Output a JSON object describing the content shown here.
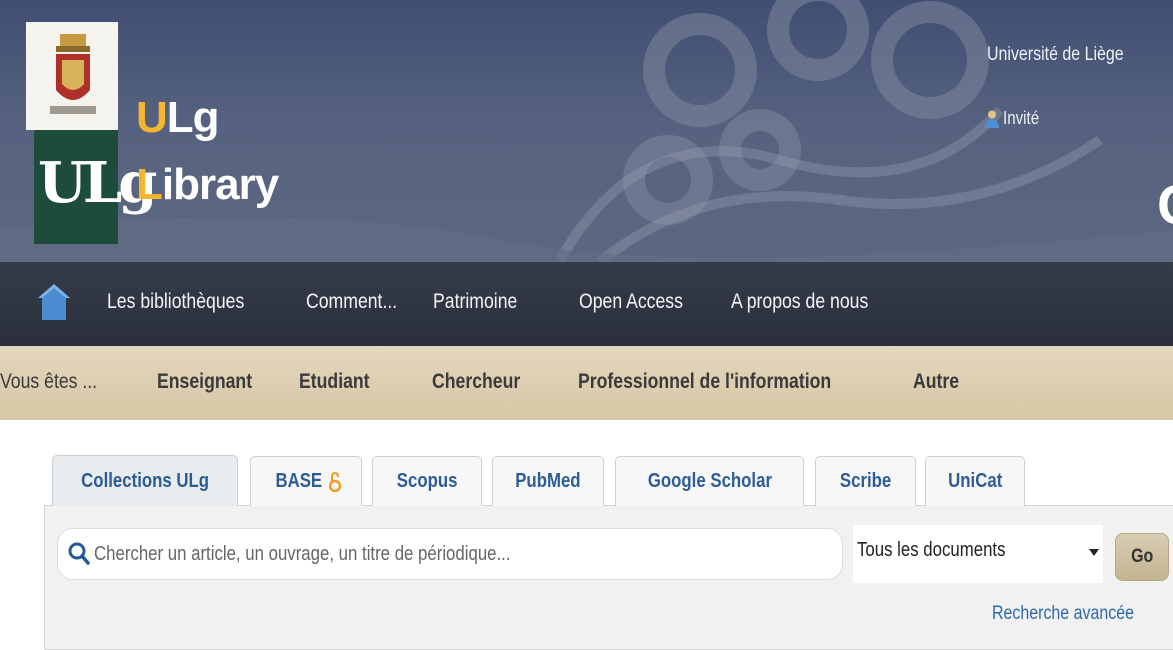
{
  "header": {
    "brand_line1_first": "U",
    "brand_line1_rest": "Lg",
    "brand_line2_first": "L",
    "brand_line2_rest": "ibrary",
    "logo_monogram": "ULg",
    "university": "Université de Liège",
    "user": "Invité",
    "partial_text": "C"
  },
  "nav": {
    "items": [
      "Les bibliothèques",
      "Comment...",
      "Patrimoine",
      "Open Access",
      "A propos de nous"
    ]
  },
  "audience": {
    "label": "Vous êtes ...",
    "items": [
      "Enseignant",
      "Etudiant",
      "Chercheur",
      "Professionnel de l'information",
      "Autre"
    ]
  },
  "search": {
    "tabs": [
      "Collections ULg",
      "BASE",
      "Scopus",
      "PubMed",
      "Google Scholar",
      "Scribe",
      "UniCat"
    ],
    "active_tab": "Collections ULg",
    "placeholder": "Chercher un article, un ouvrage, un titre de périodique...",
    "doc_type": "Tous les documents",
    "go_label": "Go",
    "advanced_label": "Recherche avancée"
  },
  "colors": {
    "header_bg": "#4a5676",
    "nav_bg": "#303643",
    "audience_bg": "#ddd0b2",
    "brand_accent": "#f2b631",
    "logo_green": "#1d4d3a",
    "link_blue": "#2e5d95"
  },
  "icons": {
    "home": "home-icon",
    "user": "user-icon",
    "search": "search-icon",
    "open_access": "lock-open-icon",
    "dropdown": "chevron-down-icon"
  }
}
